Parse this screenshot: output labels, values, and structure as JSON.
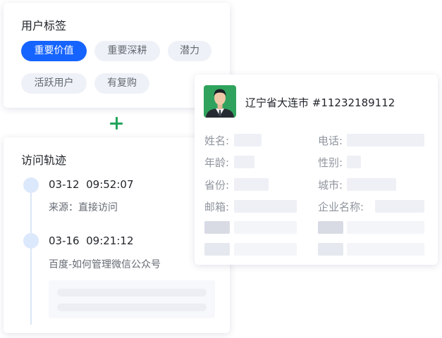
{
  "tags_card": {
    "title": "用户标签",
    "tags": [
      "重要价值",
      "重要深耕",
      "潜力",
      "活跃用户",
      "有复购"
    ],
    "active_index": 0
  },
  "visit_card": {
    "title": "访问轨迹",
    "visits": [
      {
        "time": "03-12  09:52:07",
        "desc": "来源：直接访问"
      },
      {
        "time": "03-16  09:21:12",
        "desc": "百度-如何管理微信公众号"
      }
    ]
  },
  "profile_card": {
    "name": "辽宁省大连市 #11232189112",
    "fields": {
      "name": "姓名:",
      "phone": "电话:",
      "age": "年龄:",
      "gender": "性别:",
      "province": "省份:",
      "city": "城市:",
      "email": "邮箱:",
      "company": "企业名称:"
    }
  },
  "colors": {
    "accent": "#1664ff",
    "plus": "#22a35a",
    "avatar_bg": "#2fa35d"
  },
  "icons": {
    "plus": "plus-icon",
    "avatar": "avatar"
  }
}
